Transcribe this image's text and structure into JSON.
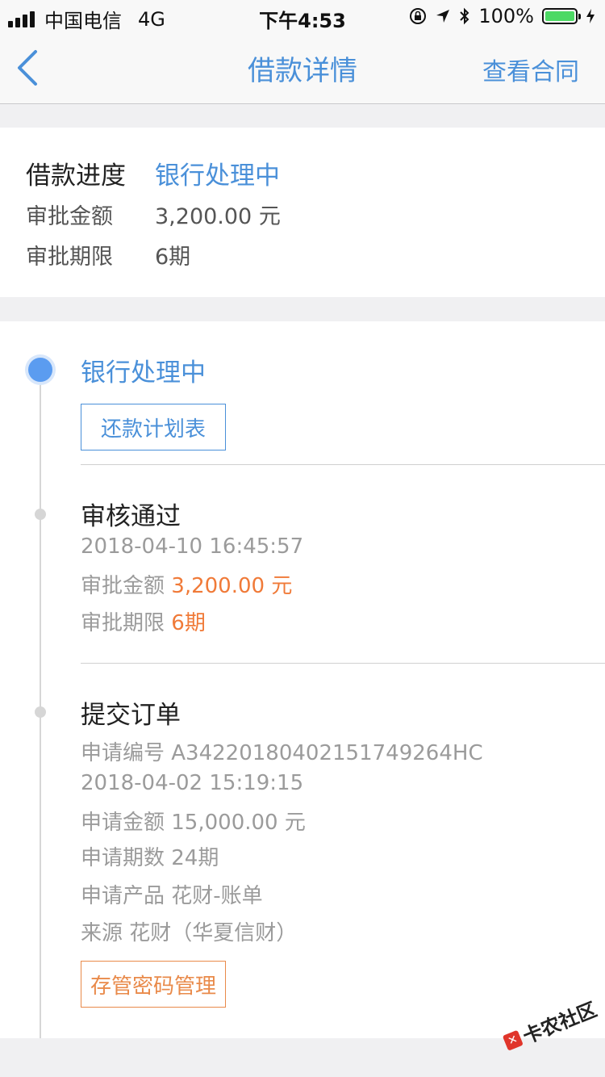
{
  "status_bar": {
    "carrier": "中国电信",
    "network": "4G",
    "time": "下午4:53",
    "battery": "100%"
  },
  "nav": {
    "title": "借款详情",
    "right_action": "查看合同"
  },
  "summary": {
    "progress_label": "借款进度",
    "progress_value": "银行处理中",
    "amount_label": "审批金额",
    "amount_value": "3,200.00 元",
    "term_label": "审批期限",
    "term_value": "6期"
  },
  "timeline": {
    "step1": {
      "title": "银行处理中",
      "button": "还款计划表"
    },
    "step2": {
      "title": "审核通过",
      "datetime": "2018-04-10 16:45:57",
      "amount_label": "审批金额",
      "amount_value": "3,200.00 元",
      "term_label": "审批期限",
      "term_value": "6期"
    },
    "step3": {
      "title": "提交订单",
      "order_no": "申请编号 A34220180402151749264HC",
      "datetime": "2018-04-02 15:19:15",
      "apply_amount": "申请金额 15,000.00 元",
      "apply_term": "申请期数 24期",
      "apply_product": "申请产品 花财-账单",
      "source": "来源 花财（华夏信财）",
      "button": "存管密码管理"
    }
  },
  "watermark": {
    "text": "卡农社区"
  },
  "colors": {
    "accent_blue": "#4a90d9",
    "highlight_orange": "#f07a38",
    "battery_green": "#4cd964"
  }
}
